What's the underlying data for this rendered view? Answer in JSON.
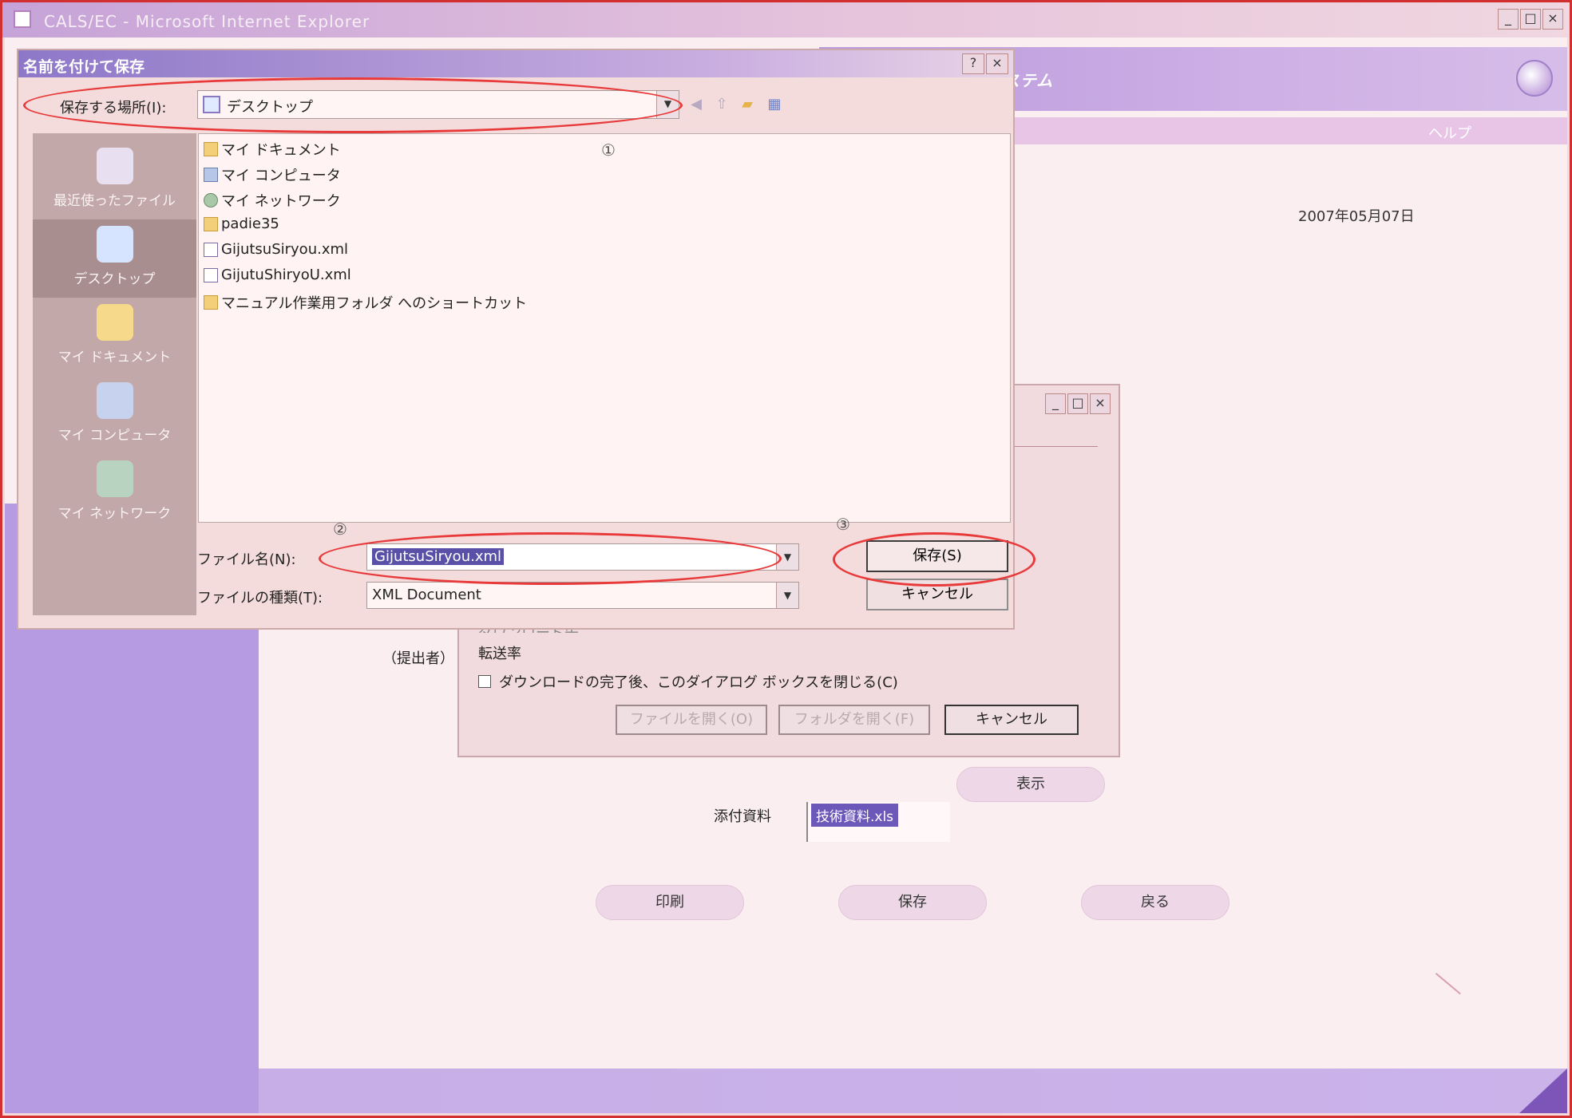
{
  "browser": {
    "title": "CALS/EC - Microsoft Internet Explorer",
    "controls": [
      "_",
      "□",
      "×"
    ]
  },
  "page": {
    "header_title": "CALS/EC 電子入札システム",
    "help_link": "ヘルプ",
    "date": "2007年05月07日",
    "attachment_label": "添付資料",
    "attachment_item": "技術資料.xls",
    "show_button": "表示",
    "print_button": "印刷",
    "save_button": "保存",
    "back_button": "戻る"
  },
  "download_dialog": {
    "controls": [
      "_",
      "□",
      "×"
    ],
    "submitter_label": "（提出者）",
    "cut_label": "ダウンロード先",
    "rate_label": "転送率",
    "close_checkbox_label": "ダウンロードの完了後、このダイアログ ボックスを閉じる(C)",
    "open_file_button": "ファイルを開く(O)",
    "open_folder_button": "フォルダを開く(F)",
    "cancel_button": "キャンセル"
  },
  "save_as_dialog": {
    "title": "名前を付けて保存",
    "controls": [
      "?",
      "×"
    ],
    "location_label": "保存する場所(I):",
    "location_value": "デスクトップ",
    "places": [
      {
        "label": "最近使ったファイル",
        "icon": "recent-icon"
      },
      {
        "label": "デスクトップ",
        "icon": "desktop-icon"
      },
      {
        "label": "マイ ドキュメント",
        "icon": "my-documents-icon"
      },
      {
        "label": "マイ コンピュータ",
        "icon": "my-computer-icon"
      },
      {
        "label": "マイ ネットワーク",
        "icon": "my-network-icon"
      }
    ],
    "files": [
      {
        "name": "マイ ドキュメント",
        "icon": "folder-icon"
      },
      {
        "name": "マイ コンピュータ",
        "icon": "computer-icon"
      },
      {
        "name": "マイ ネットワーク",
        "icon": "network-icon"
      },
      {
        "name": "padie35",
        "icon": "folder-icon"
      },
      {
        "name": "GijutsuSiryou.xml",
        "icon": "xml-file-icon"
      },
      {
        "name": "GijutuShiryoU.xml",
        "icon": "xml-file-icon"
      },
      {
        "name": "マニュアル作業用フォルダ へのショートカット",
        "icon": "folder-shortcut-icon"
      }
    ],
    "filename_label": "ファイル名(N):",
    "filename_value": "GijutsuSiryou.xml",
    "filetype_label": "ファイルの種類(T):",
    "filetype_value": "XML Document",
    "save_button": "保存(S)",
    "cancel_button": "キャンセル"
  },
  "annotations": {
    "step1": "①",
    "step2": "②",
    "step3": "③",
    "ring_color": "#e83a3a"
  }
}
